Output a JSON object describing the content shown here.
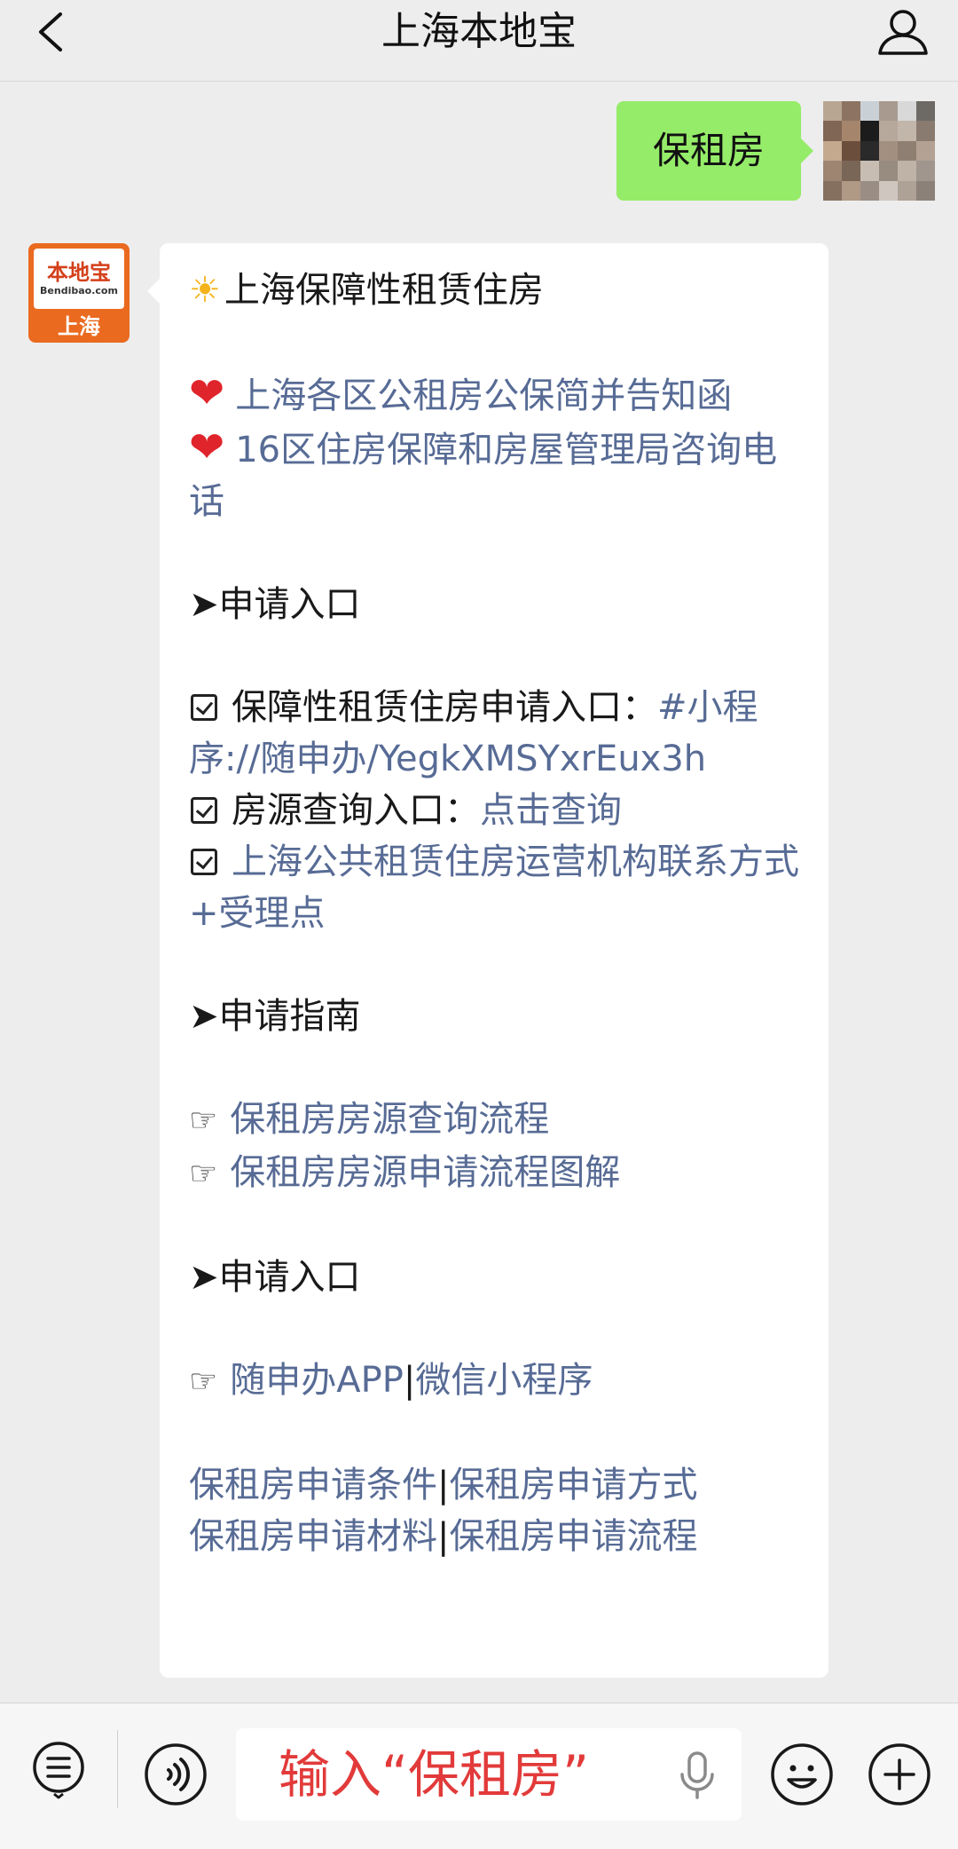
{
  "header": {
    "title": "上海本地宝",
    "back_icon": "chevron-left-icon",
    "profile_icon": "user-profile-icon"
  },
  "user_message": {
    "text": "保租房"
  },
  "bot_avatar": {
    "logo_text": "本地宝",
    "logo_domain": "Bendibao.com",
    "city": "上海"
  },
  "bot_message": {
    "title": "上海保障性租赁住房",
    "links_top": [
      "上海各区公租房公保简并告知函",
      "16区住房保障和房屋管理局咨询电话"
    ],
    "section1_title": "➤申请入口",
    "item1_label": "保障性租赁住房申请入口：",
    "item1_link": "#小程序://随申办/YegkXMSYxrEux3h",
    "item2_label": "房源查询入口：",
    "item2_link": "点击查询",
    "item3_link": "上海公共租赁住房运营机构联系方式+受理点",
    "section2_title": "➤申请指南",
    "guide_links": [
      "保租房房源查询流程",
      "保租房房源申请流程图解"
    ],
    "section3_title": "➤申请入口",
    "app_link1": "随申办APP",
    "app_sep": "|",
    "app_link2": "微信小程序",
    "footer_link1": "保租房申请条件",
    "footer_link2": "保租房申请方式",
    "footer_link3": "保租房申请材料",
    "footer_link4": "保租房申请流程",
    "footer_sep": "|"
  },
  "bottom_bar": {
    "input_text": "输入“保租房”",
    "icons": [
      "menu-list-icon",
      "voice-icon",
      "microphone-icon",
      "emoji-icon",
      "plus-icon"
    ]
  },
  "colors": {
    "background": "#ededed",
    "user_bubble": "#95ec69",
    "link": "#576b95",
    "input_hint": "#e23a3a",
    "brand_orange": "#ea6a1f"
  }
}
